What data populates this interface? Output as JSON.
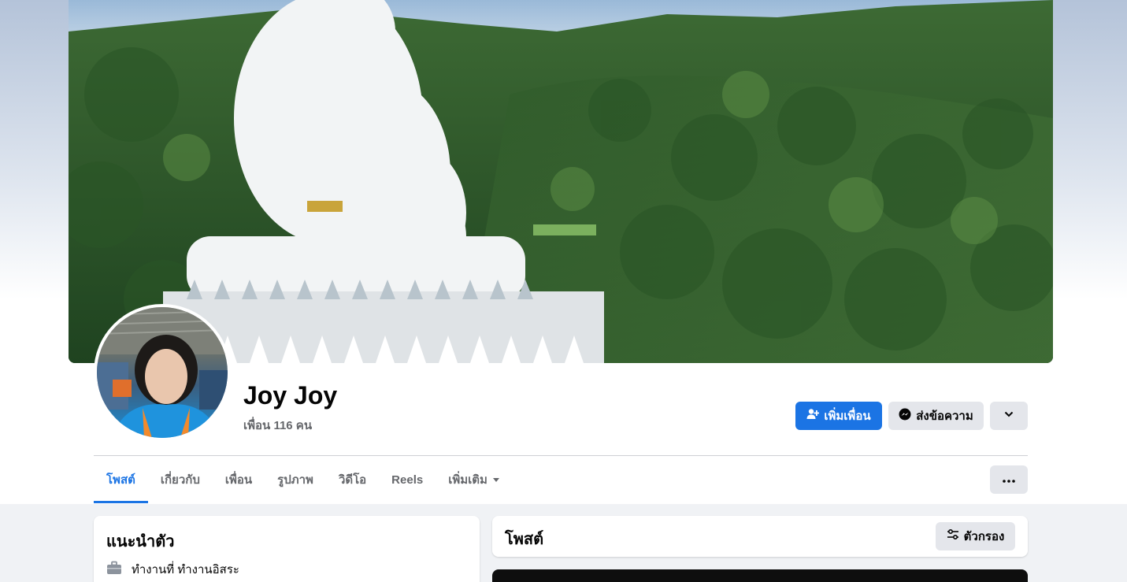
{
  "profile": {
    "name": "Joy Joy",
    "friends_text": "เพื่อน 116 คน"
  },
  "actions": {
    "add_friend": "เพิ่มเพื่อน",
    "message": "ส่งข้อความ",
    "add_friend_icon": "add-friend-icon",
    "message_icon": "messenger-icon",
    "chevron_icon": "chevron-down-icon"
  },
  "tabs": [
    {
      "label": "โพสต์",
      "active": true
    },
    {
      "label": "เกี่ยวกับ",
      "active": false
    },
    {
      "label": "เพื่อน",
      "active": false
    },
    {
      "label": "รูปภาพ",
      "active": false
    },
    {
      "label": "วิดีโอ",
      "active": false
    },
    {
      "label": "Reels",
      "active": false
    },
    {
      "label": "เพิ่มเติม",
      "active": false
    }
  ],
  "intro": {
    "title": "แนะนำตัว",
    "work": "ทำงานที่ ทำงานอิสระ"
  },
  "posts": {
    "title": "โพสต์",
    "filter": "ตัวกรอง"
  },
  "colors": {
    "accent": "#1b74e4",
    "secondary_button": "#e4e6eb",
    "background": "#f0f2f5"
  }
}
